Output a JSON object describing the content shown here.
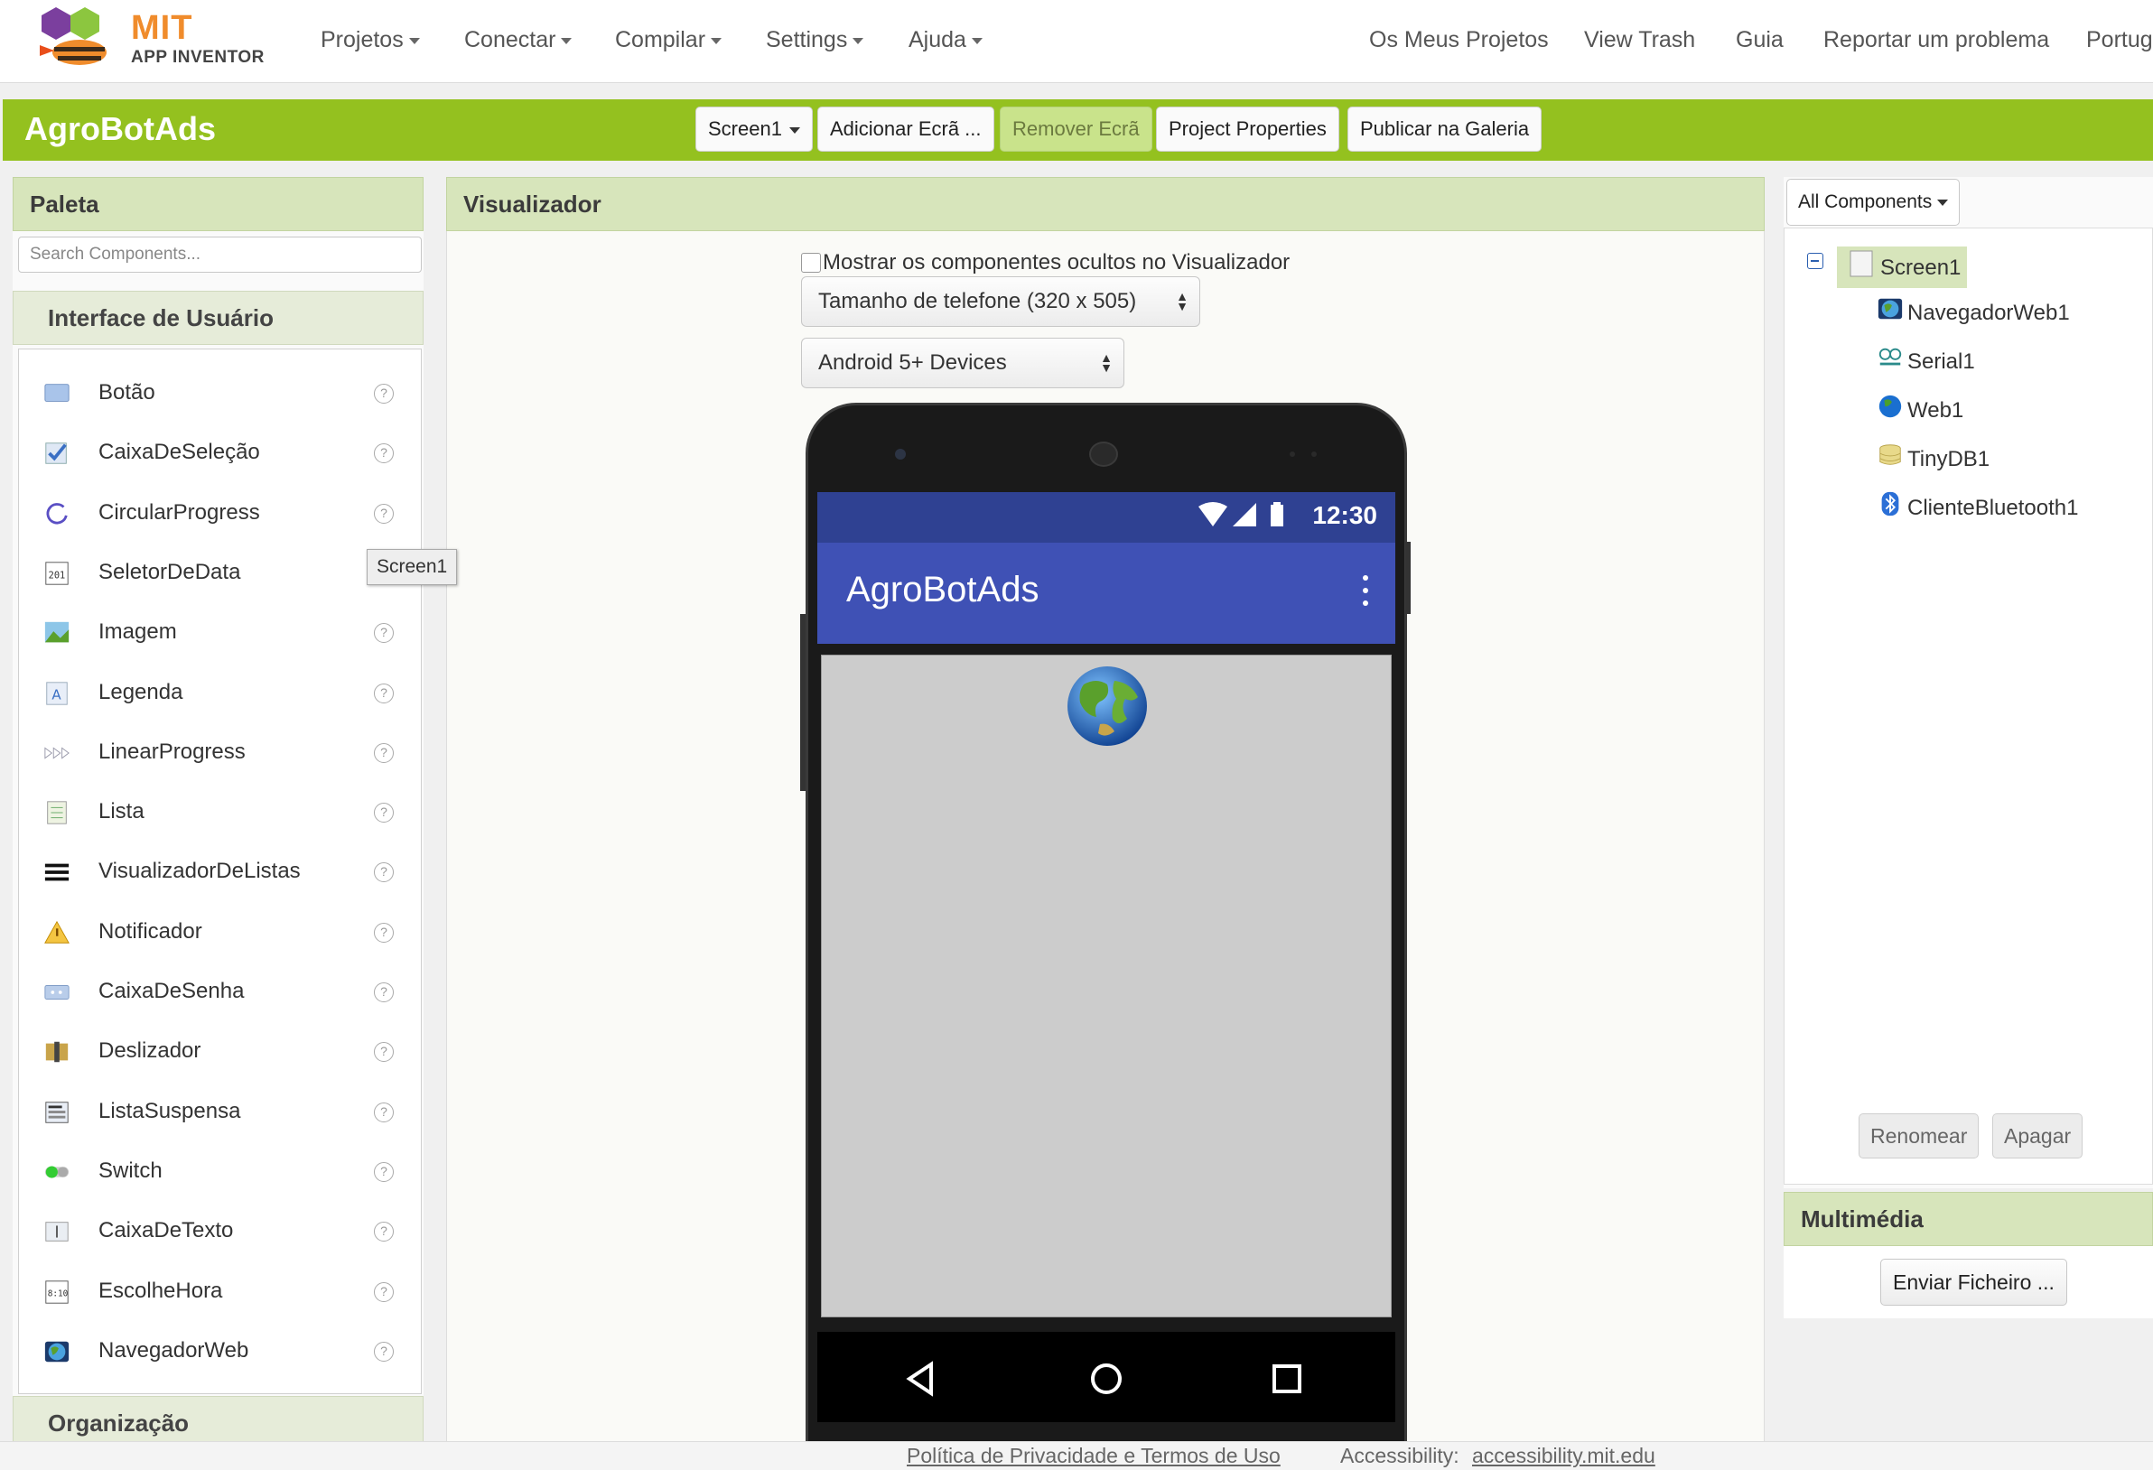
{
  "brand": {
    "mit": "MIT",
    "app_inventor": "APP INVENTOR"
  },
  "topnav": {
    "menus": [
      "Projetos",
      "Conectar",
      "Compilar",
      "Settings",
      "Ajuda"
    ],
    "links": [
      "Os Meus Projetos",
      "View Trash",
      "Guia",
      "Reportar um problema",
      "Portug"
    ]
  },
  "project": {
    "name": "AgroBotAds",
    "screen_select": "Screen1",
    "add_screen": "Adicionar Ecrã ...",
    "remove_screen": "Remover Ecrã",
    "properties": "Project Properties",
    "publish": "Publicar na Galeria"
  },
  "palette": {
    "title": "Paleta",
    "search_placeholder": "Search Components...",
    "category": "Interface de Usuário",
    "next_category": "Organização",
    "items": [
      {
        "label": "Botão",
        "icon": "button-icon"
      },
      {
        "label": "CaixaDeSeleção",
        "icon": "checkbox-icon"
      },
      {
        "label": "CircularProgress",
        "icon": "circular-progress-icon"
      },
      {
        "label": "SeletorDeData",
        "icon": "calendar-icon"
      },
      {
        "label": "Imagem",
        "icon": "image-icon"
      },
      {
        "label": "Legenda",
        "icon": "label-icon"
      },
      {
        "label": "LinearProgress",
        "icon": "linear-progress-icon"
      },
      {
        "label": "Lista",
        "icon": "list-icon"
      },
      {
        "label": "VisualizadorDeListas",
        "icon": "list-view-icon"
      },
      {
        "label": "Notificador",
        "icon": "warning-icon"
      },
      {
        "label": "CaixaDeSenha",
        "icon": "password-icon"
      },
      {
        "label": "Deslizador",
        "icon": "slider-icon"
      },
      {
        "label": "ListaSuspensa",
        "icon": "spinner-icon"
      },
      {
        "label": "Switch",
        "icon": "switch-icon"
      },
      {
        "label": "CaixaDeTexto",
        "icon": "textbox-icon"
      },
      {
        "label": "EscolheHora",
        "icon": "clock-icon"
      },
      {
        "label": "NavegadorWeb",
        "icon": "web-viewer-icon"
      }
    ],
    "help_glyph": "?"
  },
  "viewer": {
    "title": "Visualizador",
    "show_hidden_label": "Mostrar os componentes ocultos no Visualizador",
    "phone_size": "Tamanho de telefone (320 x 505)",
    "device": "Android 5+ Devices",
    "status_time": "12:30",
    "app_title": "AgroBotAds",
    "screen_tooltip": "Screen1"
  },
  "components": {
    "filter": "All Components",
    "root": "Screen1",
    "children": [
      {
        "label": "NavegadorWeb1",
        "icon": "web-viewer-icon"
      },
      {
        "label": "Serial1",
        "icon": "serial-icon"
      },
      {
        "label": "Web1",
        "icon": "globe-icon"
      },
      {
        "label": "TinyDB1",
        "icon": "database-icon"
      },
      {
        "label": "ClienteBluetooth1",
        "icon": "bluetooth-icon"
      }
    ],
    "rename": "Renomear",
    "delete": "Apagar"
  },
  "media": {
    "title": "Multimédia",
    "upload": "Enviar Ficheiro ..."
  },
  "footer": {
    "privacy": "Política de Privacidade e Termos de Uso",
    "accessibility_label": "Accessibility:",
    "accessibility_link": "accessibility.mit.edu"
  },
  "colors": {
    "accent_green": "#94c11f",
    "panel_head": "#d7e5bb",
    "app_bar": "#3f51b5",
    "status_bar": "#2f4192"
  }
}
